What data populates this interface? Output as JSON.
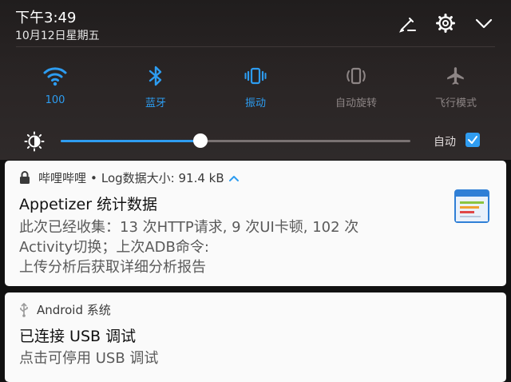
{
  "status": {
    "time": "下午3:49",
    "date": "10月12日星期五"
  },
  "header_icons": [
    "edit-icon",
    "settings-icon",
    "chevron-down-icon"
  ],
  "quick_settings": [
    {
      "id": "wifi",
      "label": "100",
      "icon": "wifi-icon",
      "active": true
    },
    {
      "id": "bluetooth",
      "label": "蓝牙",
      "icon": "bluetooth-icon",
      "active": true
    },
    {
      "id": "vibrate",
      "label": "振动",
      "icon": "vibrate-icon",
      "active": true
    },
    {
      "id": "autorotate",
      "label": "自动旋转",
      "icon": "auto-rotate-icon",
      "active": false
    },
    {
      "id": "airplane",
      "label": "飞行模式",
      "icon": "airplane-icon",
      "active": false
    }
  ],
  "brightness": {
    "level_fraction": 0.4,
    "auto_label": "自动",
    "auto_checked": true
  },
  "notifications": [
    {
      "app": "哔哩哔哩",
      "separator": "•",
      "subtext": "Log数据大小: 91.4 kB",
      "title": "Appetizer 统计数据",
      "body_lines": [
        "此次已经收集：13 次HTTP请求, 9 次UI卡顿, 102 次",
        "Activity切换；上次ADB命令:",
        "上传分析后获取详细分析报告"
      ]
    },
    {
      "app": "Android 系统",
      "title": "已连接 USB 调试",
      "body": "点击可停用 USB 调试"
    }
  ],
  "colors": {
    "accent": "#2f9cf0",
    "shade_bg": "#2a2525",
    "card_bg": "#fafafa",
    "inactive": "#8d8585"
  }
}
